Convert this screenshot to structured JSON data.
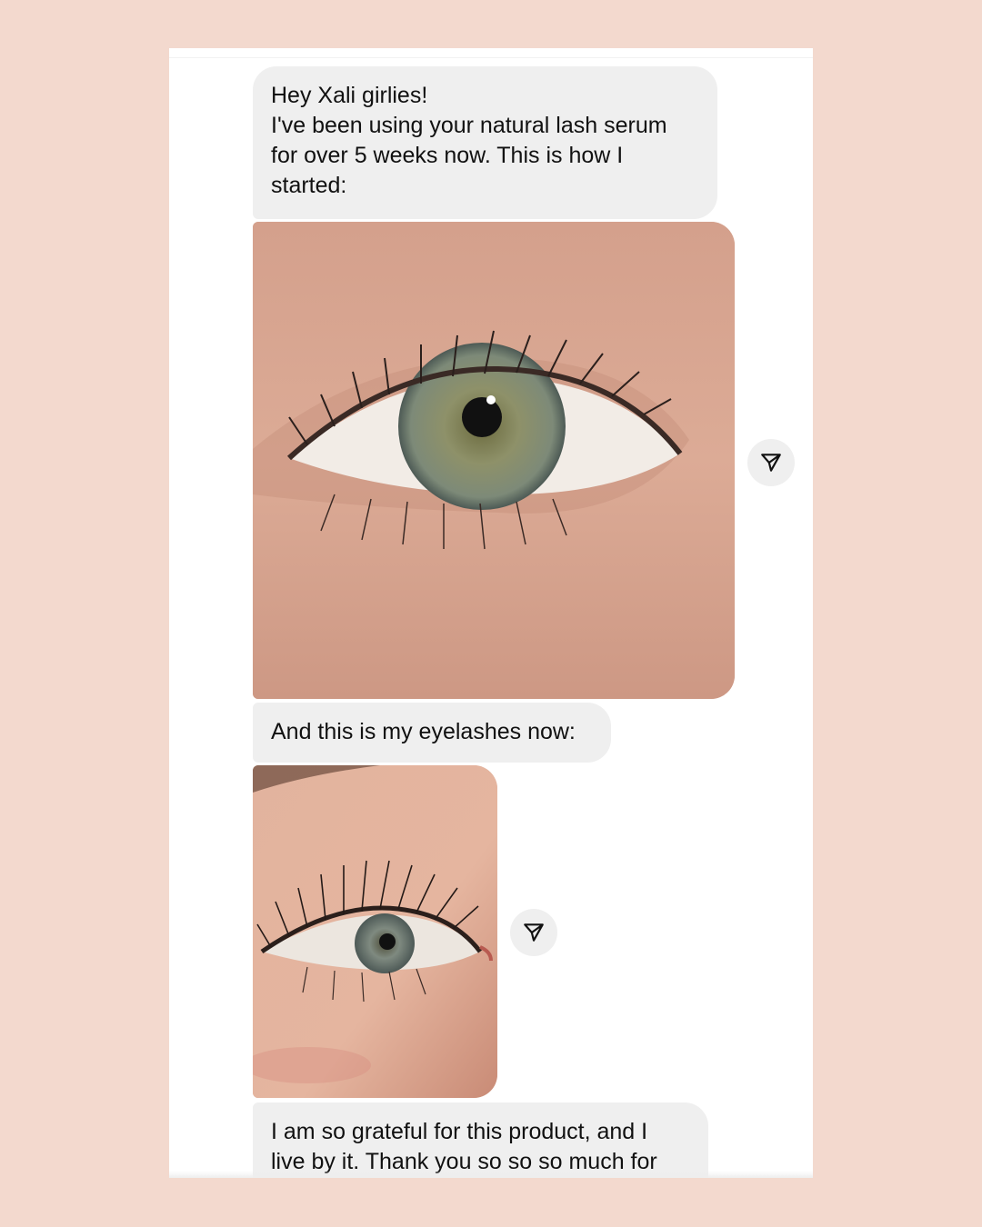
{
  "messages": [
    {
      "lines": [
        "Hey Xali girlies!",
        "I've been using your natural lash serum",
        "for over 5 weeks now. This is how I",
        "started:"
      ]
    },
    {
      "lines": [
        "And this is my eyelashes now:"
      ]
    },
    {
      "lines": [
        "I am so grateful for this product, and I",
        "live by it. Thank you so so so much for"
      ]
    }
  ],
  "images": {
    "before_photo": "eye-closeup-before",
    "after_photo": "eye-closeup-after"
  },
  "icons": {
    "share": "send-arrow-icon"
  },
  "colors": {
    "page_background": "#f3d9ce",
    "bubble_background": "#efefef",
    "text": "#111111"
  }
}
